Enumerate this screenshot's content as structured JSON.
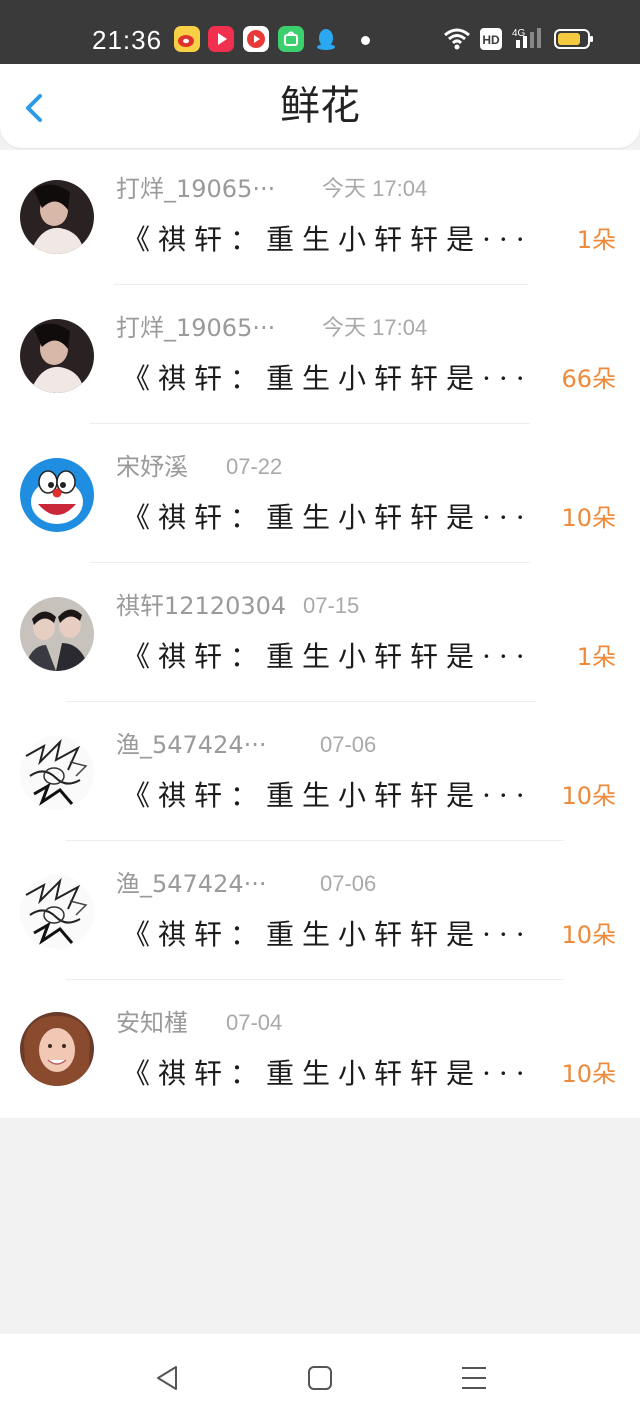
{
  "status_bar": {
    "time": "21:36",
    "app_icons": [
      "weibo-icon",
      "video-play-icon",
      "media-play-icon",
      "app-store-icon",
      "qq-icon"
    ],
    "right_icons": [
      "wifi-icon",
      "hd-icon",
      "signal-4g-icon",
      "battery-icon"
    ],
    "network_label": "4G",
    "hd_label": "HD"
  },
  "header": {
    "title": "鲜花",
    "back_icon": "chevron-left-icon",
    "accent": "#2b9be6"
  },
  "gifts": [
    {
      "user": "打烊_19065···",
      "time": "今天 17:04",
      "book": "《祺轩：重生小轩轩是···",
      "count": "1朵"
    },
    {
      "user": "打烊_19065···",
      "time": "今天 17:04",
      "book": "《祺轩：重生小轩轩是···",
      "count": "66朵"
    },
    {
      "user": "宋妤溪",
      "time": "07-22",
      "book": "《祺轩：重生小轩轩是···",
      "count": "10朵"
    },
    {
      "user": "祺轩12120304",
      "time": "07-15",
      "book": "《祺轩：重生小轩轩是···",
      "count": "1朵"
    },
    {
      "user": "渔_547424···",
      "time": "07-06",
      "book": "《祺轩：重生小轩轩是···",
      "count": "10朵"
    },
    {
      "user": "渔_547424···",
      "time": "07-06",
      "book": "《祺轩：重生小轩轩是···",
      "count": "10朵"
    },
    {
      "user": "安知槿",
      "time": "07-04",
      "book": "《祺轩：重生小轩轩是···",
      "count": "10朵"
    }
  ],
  "colors": {
    "count": "#ef8a3b",
    "username": "#9a9a9a",
    "background": "#f3f2f3"
  },
  "nav_bar": {
    "icons": [
      "back-triangle-icon",
      "home-square-icon",
      "menu-lines-icon"
    ]
  }
}
